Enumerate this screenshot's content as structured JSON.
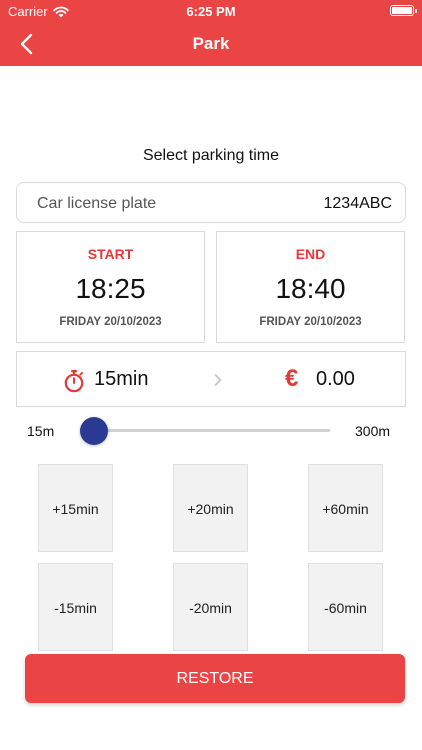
{
  "status_bar": {
    "carrier": "Carrier",
    "time": "6:25 PM"
  },
  "nav": {
    "title": "Park",
    "back_icon": "chevron-left-icon"
  },
  "section_title": "Select parking time",
  "plate": {
    "label": "Car license plate",
    "value": "1234ABC"
  },
  "start": {
    "label": "START",
    "time": "18:25",
    "date": "FRIDAY 20/10/2023"
  },
  "end": {
    "label": "END",
    "time": "18:40",
    "date": "FRIDAY 20/10/2023"
  },
  "summary": {
    "duration": "15min",
    "currency_symbol": "€",
    "price": "0.00"
  },
  "slider": {
    "min_label": "15m",
    "max_label": "300m",
    "min_minutes": 15,
    "max_minutes": 300,
    "value_minutes": 15
  },
  "adjust_buttons": {
    "plus": [
      "+15min",
      "+20min",
      "+60min"
    ],
    "minus": [
      "-15min",
      "-20min",
      "-60min"
    ]
  },
  "restore_label": "RESTORE",
  "colors": {
    "accent": "#ea4544",
    "slider": "#2b3a93",
    "border": "#dadada",
    "button_bg": "#f2f2f2"
  }
}
